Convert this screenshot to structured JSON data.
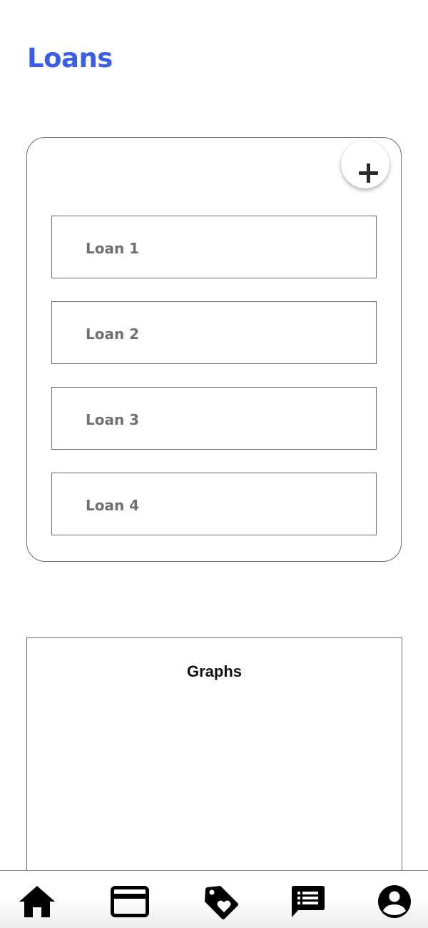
{
  "header": {
    "title": "Loans",
    "title_color": "#3a5fe5"
  },
  "loans_card": {
    "add_button_icon": "plus-icon",
    "items": [
      {
        "label": "Loan 1"
      },
      {
        "label": "Loan 2"
      },
      {
        "label": "Loan 3"
      },
      {
        "label": "Loan 4"
      }
    ]
  },
  "graphs": {
    "title": "Graphs"
  },
  "bottom_nav": {
    "items": [
      {
        "icon": "home-icon"
      },
      {
        "icon": "credit-card-icon"
      },
      {
        "icon": "tag-heart-icon"
      },
      {
        "icon": "message-list-icon"
      },
      {
        "icon": "account-circle-icon"
      }
    ]
  }
}
